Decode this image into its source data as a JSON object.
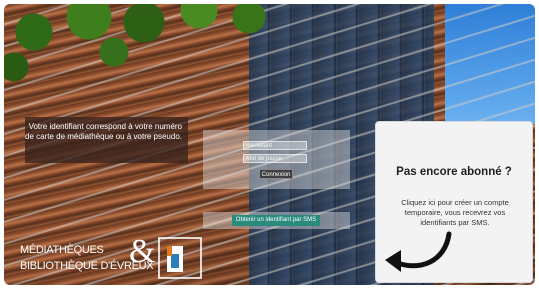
{
  "login": {
    "info_text": "Votre identifiant correspond à votre numéro de carte de médiathèque ou à votre pseudo.",
    "username_placeholder": "Identifiant",
    "password_placeholder": "Mot de passe",
    "connect_label": "Connexion"
  },
  "sms": {
    "button_label": "Obtenir un identifiant par SMS"
  },
  "subscribe": {
    "title": "Pas encore abonné ?",
    "text": "Cliquez ici pour créer un compte temporaire, vous recevrez vos identifiants par SMS.",
    "arrow_icon": "curved-arrow-icon"
  },
  "logo": {
    "line1": "MÉDIATHÈQUES",
    "line2": "BIBLIOTHÈQUE D'ÉVREUX",
    "icon": "ampersand-building-icon"
  },
  "colors": {
    "sms_button": "#2a8a7c",
    "connect_button": "#3f3f3f",
    "info_box": "#37231e",
    "card_bg": "#f3f3f3"
  }
}
